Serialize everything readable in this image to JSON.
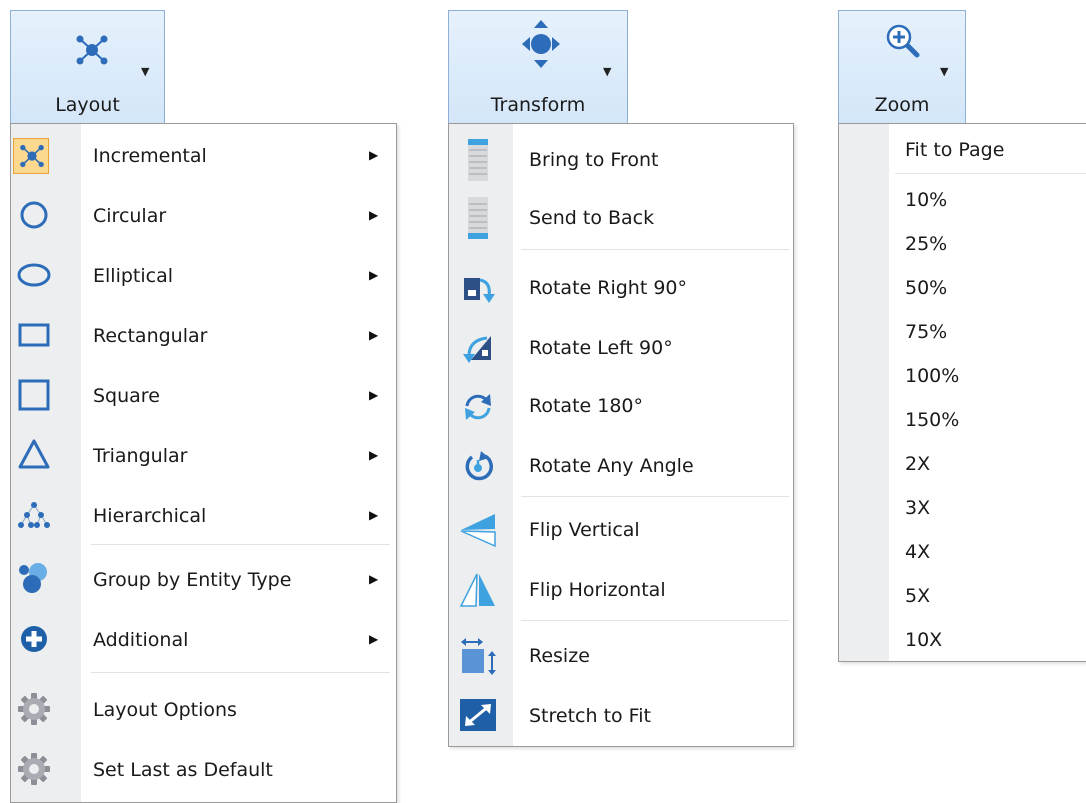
{
  "colors": {
    "accent": "#2c6cb8",
    "tab_bg": "#d8e8f8",
    "gutter": "#eceeef",
    "highlight": "#fcd98f"
  },
  "layout_tab": {
    "label": "Layout",
    "icon": "layout-network-icon"
  },
  "transform_tab": {
    "label": "Transform",
    "icon": "move-arrows-icon"
  },
  "zoom_tab": {
    "label": "Zoom",
    "icon": "zoom-in-icon"
  },
  "layout_menu": {
    "items": [
      {
        "label": "Incremental",
        "icon": "incremental-layout-icon",
        "submenu": true,
        "selected": true
      },
      {
        "label": "Circular",
        "icon": "circle-icon",
        "submenu": true
      },
      {
        "label": "Elliptical",
        "icon": "ellipse-icon",
        "submenu": true
      },
      {
        "label": "Rectangular",
        "icon": "rectangle-icon",
        "submenu": true
      },
      {
        "label": "Square",
        "icon": "square-icon",
        "submenu": true
      },
      {
        "label": "Triangular",
        "icon": "triangle-icon",
        "submenu": true
      },
      {
        "label": "Hierarchical",
        "icon": "hierarchy-icon",
        "submenu": true
      },
      {
        "label": "Group by Entity Type",
        "icon": "group-icon",
        "submenu": true
      },
      {
        "label": "Additional",
        "icon": "plus-circle-icon",
        "submenu": true
      },
      {
        "label": "Layout Options",
        "icon": "gear-icon",
        "submenu": false
      },
      {
        "label": "Set Last as Default",
        "icon": "gear-icon",
        "submenu": false
      }
    ]
  },
  "transform_menu": {
    "items": [
      {
        "label": "Bring to Front",
        "icon": "bring-front-icon"
      },
      {
        "label": "Send to Back",
        "icon": "send-back-icon"
      },
      {
        "label": "Rotate Right 90°",
        "icon": "rotate-right-icon"
      },
      {
        "label": "Rotate Left 90°",
        "icon": "rotate-left-icon"
      },
      {
        "label": "Rotate 180°",
        "icon": "rotate-180-icon"
      },
      {
        "label": "Rotate Any Angle",
        "icon": "rotate-any-icon"
      },
      {
        "label": "Flip Vertical",
        "icon": "flip-vertical-icon"
      },
      {
        "label": "Flip Horizontal",
        "icon": "flip-horizontal-icon"
      },
      {
        "label": "Resize",
        "icon": "resize-icon"
      },
      {
        "label": "Stretch to Fit",
        "icon": "stretch-icon"
      }
    ]
  },
  "zoom_menu": {
    "items": [
      "Fit to Page",
      "10%",
      "25%",
      "50%",
      "75%",
      "100%",
      "150%",
      "2X",
      "3X",
      "4X",
      "5X",
      "10X"
    ]
  }
}
